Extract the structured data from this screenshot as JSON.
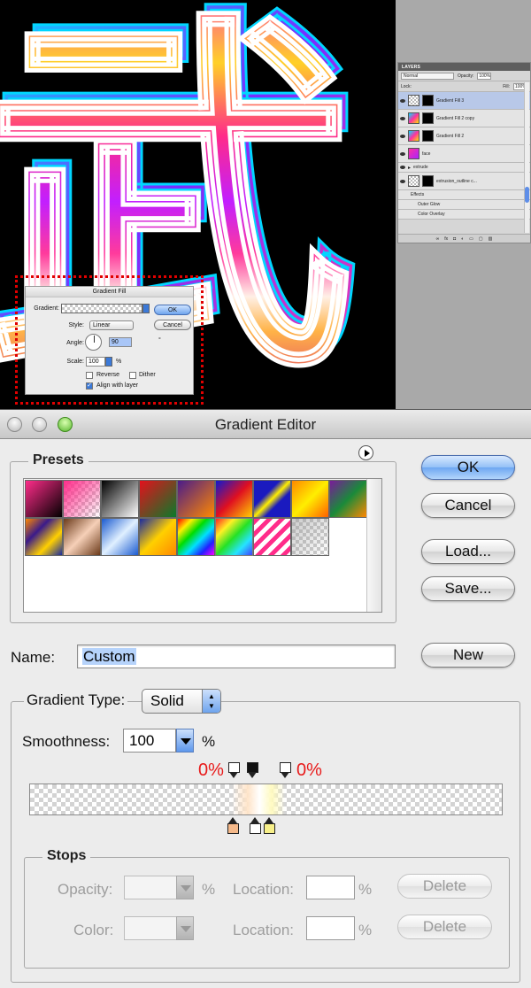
{
  "artwork": {
    "glyph": "武"
  },
  "layers_panel": {
    "tab": "LAYERS",
    "blend_mode": "Normal",
    "opacity_label": "Opacity:",
    "opacity_value": "100%",
    "lock_label": "Lock:",
    "fill_label": "Fill:",
    "fill_value": "100%",
    "layers": [
      {
        "name": "Gradient Fill 3"
      },
      {
        "name": "Gradient Fill 2 copy"
      },
      {
        "name": "Gradient Fill 2"
      },
      {
        "name": "face"
      },
      {
        "name": "extrude"
      },
      {
        "name": "extrusion_outline c..."
      },
      {
        "name": "Effects"
      },
      {
        "name": "Outer Glow"
      },
      {
        "name": "Color Overlay"
      }
    ]
  },
  "gradient_fill_dialog": {
    "title": "Gradient Fill",
    "gradient_label": "Gradient:",
    "style_label": "Style:",
    "style_value": "Linear",
    "angle_label": "Angle:",
    "angle_value": "90",
    "angle_unit": "°",
    "scale_label": "Scale:",
    "scale_value": "100",
    "scale_unit": "%",
    "reverse_label": "Reverse",
    "dither_label": "Dither",
    "align_label": "Align with layer",
    "ok": "OK",
    "cancel": "Cancel"
  },
  "gradient_editor": {
    "title": "Gradient Editor",
    "presets_label": "Presets",
    "buttons": {
      "ok": "OK",
      "cancel": "Cancel",
      "load": "Load...",
      "save": "Save...",
      "new": "New"
    },
    "name_label": "Name:",
    "name_value": "Custom",
    "gradient_type_label": "Gradient Type:",
    "gradient_type_value": "Solid",
    "smoothness_label": "Smoothness:",
    "smoothness_value": "100",
    "smoothness_unit": "%",
    "opacity_stop_left_value": "0%",
    "opacity_stop_right_value": "0%",
    "stops": {
      "legend": "Stops",
      "opacity_label": "Opacity:",
      "color_label": "Color:",
      "location_label": "Location:",
      "pct": "%",
      "delete": "Delete"
    }
  },
  "colors": {
    "selection_blue": "#b6d3fb",
    "default_button_blue": "#6ea7f1",
    "annotation_red": "#e81a1a"
  }
}
